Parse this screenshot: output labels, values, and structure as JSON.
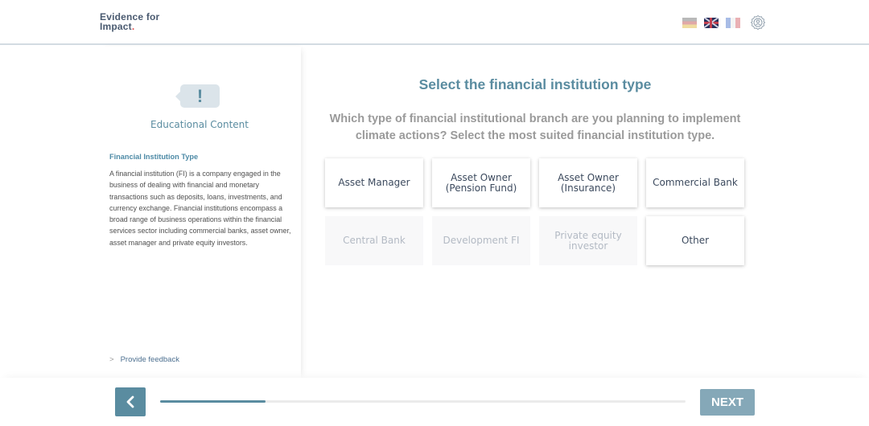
{
  "header": {
    "logo_line1": "Evidence for",
    "logo_line2": "Impact",
    "logo_dot": ".",
    "languages": [
      {
        "code": "de",
        "icon": "german-flag-icon"
      },
      {
        "code": "en",
        "icon": "uk-flag-icon"
      },
      {
        "code": "fr",
        "icon": "french-flag-icon"
      }
    ],
    "settings_icon": "user-settings-gear-icon"
  },
  "sidebar": {
    "badge_symbol": "!",
    "title": "Educational Content",
    "section_heading": "Financial Institution Type",
    "section_text": "A financial institution (FI) is a company engaged in the business of dealing with financial and monetary transactions such as deposits, loans, investments, and currency exchange. Financial institutions encompass a broad range of business operations within the financial services sector including commercial banks, asset owner, asset manager and private equity investors.",
    "feedback_chevron": ">",
    "feedback_label": "Provide feedback"
  },
  "main": {
    "title": "Select the financial institution type",
    "question": "Which type of financial institutional branch are you planning to implement climate actions? Select the most suited financial institution type.",
    "options": [
      {
        "label": "Asset Manager",
        "enabled": true
      },
      {
        "label": "Asset Owner (Pension Fund)",
        "enabled": true
      },
      {
        "label": "Asset Owner (Insurance)",
        "enabled": true
      },
      {
        "label": "Commercial Bank",
        "enabled": true
      },
      {
        "label": "Central Bank",
        "enabled": false
      },
      {
        "label": "Development FI",
        "enabled": false
      },
      {
        "label": "Private equity investor",
        "enabled": false
      },
      {
        "label": "Other",
        "enabled": true
      }
    ]
  },
  "footer": {
    "back_icon": "chevron-left-icon",
    "progress_percent": 20,
    "next_label": "NEXT"
  },
  "colors": {
    "accent": "#5a8ca0",
    "next_button": "#85a8b8",
    "logo_text": "#4a5a70",
    "logo_dot": "#e04a4a"
  }
}
